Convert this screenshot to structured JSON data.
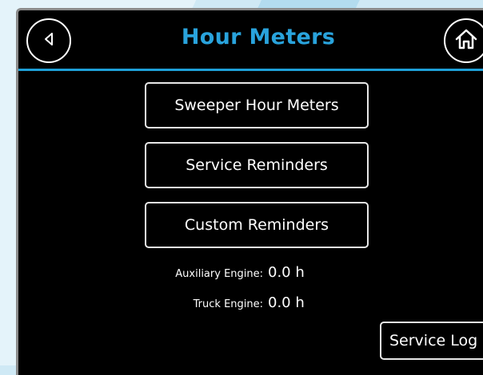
{
  "header": {
    "title": "Hour Meters",
    "back_icon": "back-triangle-icon",
    "home_icon": "home-icon",
    "accent_color": "#29a3dc"
  },
  "menu": {
    "items": [
      {
        "label": "Sweeper Hour Meters"
      },
      {
        "label": "Service Reminders"
      },
      {
        "label": "Custom Reminders"
      }
    ]
  },
  "readings": {
    "auxiliary": {
      "label": "Auxiliary Engine:",
      "value": "0.0 h"
    },
    "truck": {
      "label": "Truck Engine:",
      "value": "0.0 h"
    }
  },
  "footer": {
    "service_log_label": "Service Log"
  }
}
